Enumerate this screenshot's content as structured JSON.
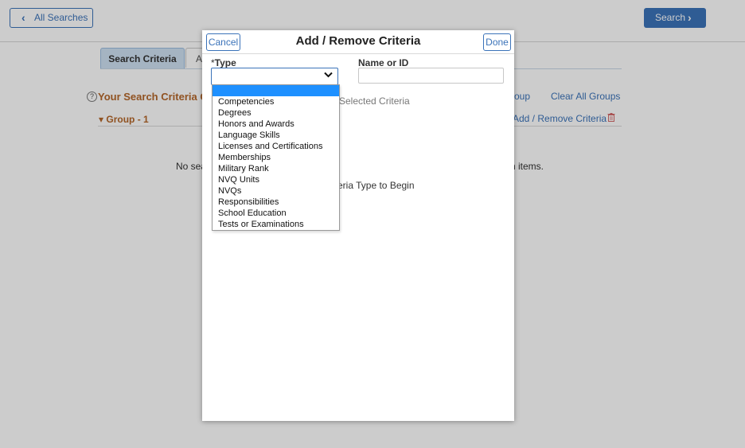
{
  "header": {
    "back_label": "All Searches",
    "search_label": "Search"
  },
  "tabs": [
    {
      "label": "Search Criteria",
      "active": true
    },
    {
      "label": "A",
      "active": false
    }
  ],
  "criteria": {
    "title": "Your Search Criteria Gr",
    "add_group_fragment": "oup",
    "clear_all_label": "Clear All Groups",
    "group_label": "Group - 1",
    "add_remove_label": "Add / Remove Criteria",
    "no_search_left": "No sea",
    "no_search_right": "h items."
  },
  "modal": {
    "title": "Add / Remove Criteria",
    "cancel_label": "Cancel",
    "done_label": "Done",
    "type_required": "*",
    "type_label": "Type",
    "name_label": "Name or ID",
    "name_value": "",
    "selected_criteria_label": "Selected Criteria",
    "begin_text": "riteria Type to Begin",
    "type_value": "",
    "type_options": [
      "Competencies",
      "Degrees",
      "Honors and Awards",
      "Language Skills",
      "Licenses and Certifications",
      "Memberships",
      "Military Rank",
      "NVQ Units",
      "NVQs",
      "Responsibilities",
      "School Education",
      "Tests or Examinations"
    ]
  },
  "icons": {
    "back": "chevron-left-icon",
    "search": "chevron-right-icon",
    "help": "help-circle-icon",
    "group_toggle": "caret-down-icon",
    "delete": "trash-icon",
    "select": "chevron-down-icon"
  },
  "colors": {
    "accent": "#3b73b9",
    "criteria_title": "#b5672a",
    "highlight": "#1e90ff",
    "delete": "#c0392b"
  }
}
